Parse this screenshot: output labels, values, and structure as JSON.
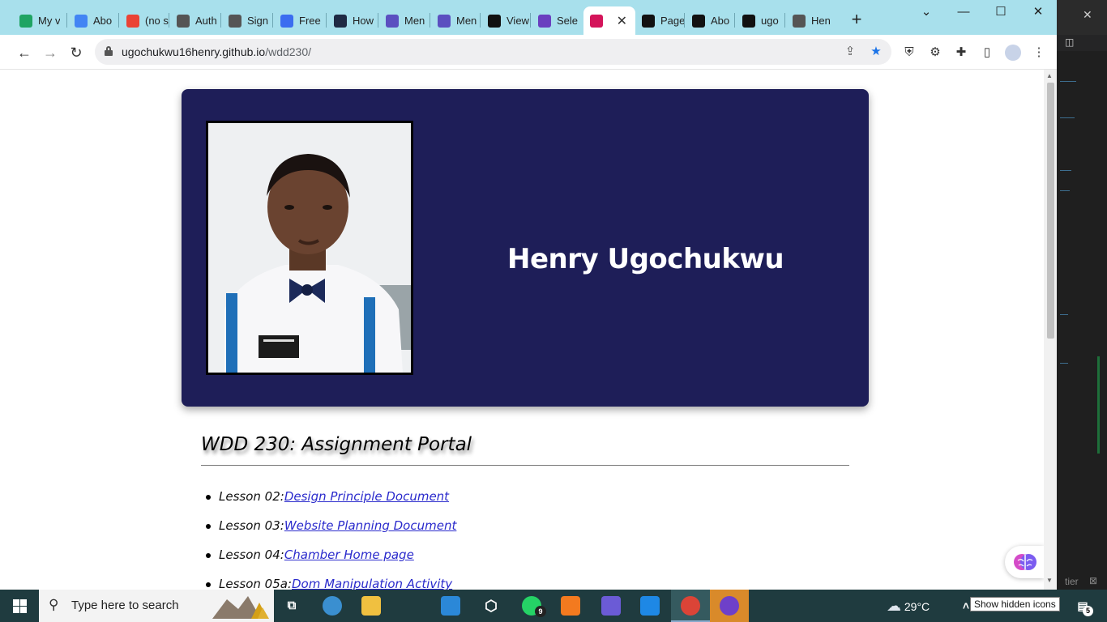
{
  "browser": {
    "tabs": [
      {
        "label": "My v",
        "icon": "google-drive-icon",
        "color": "#1fa463"
      },
      {
        "label": "Abo",
        "icon": "google-docs-icon",
        "color": "#4285f4"
      },
      {
        "label": "(no s",
        "icon": "gmail-icon",
        "color": "#ea4335"
      },
      {
        "label": "Auth",
        "icon": "globe-icon",
        "color": "#555555"
      },
      {
        "label": "Sign",
        "icon": "globe-icon",
        "color": "#555555"
      },
      {
        "label": "Free",
        "icon": "p-app-icon",
        "color": "#3b6df0"
      },
      {
        "label": "How",
        "icon": "a-app-icon",
        "color": "#1f2a44"
      },
      {
        "label": "Men",
        "icon": "forms-icon",
        "color": "#5b4fc0"
      },
      {
        "label": "Men",
        "icon": "forms-icon",
        "color": "#5b4fc0"
      },
      {
        "label": "View",
        "icon": "github-icon",
        "color": "#111111"
      },
      {
        "label": "Sele",
        "icon": "list-icon",
        "color": "#6a3fbf"
      },
      {
        "label": "",
        "icon": "m-logo-icon",
        "color": "#d4145a",
        "active": true
      },
      {
        "label": "Page",
        "icon": "github-icon",
        "color": "#111111"
      },
      {
        "label": "Abo",
        "icon": "github-icon",
        "color": "#111111"
      },
      {
        "label": "ugo",
        "icon": "github-icon",
        "color": "#111111"
      },
      {
        "label": "Hen",
        "icon": "globe-icon",
        "color": "#555555"
      }
    ],
    "url_host": "ugochukwu16henry.github.io",
    "url_path": "/wdd230/"
  },
  "page": {
    "name": "Henry Ugochukwu",
    "section_title": "WDD 230: Assignment Portal",
    "lessons": [
      {
        "prefix": "Lesson 02:",
        "link": "Design Principle Document"
      },
      {
        "prefix": "Lesson 03:",
        "link": "Website Planning Document"
      },
      {
        "prefix": "Lesson 04:",
        "link": "Chamber Home page"
      },
      {
        "prefix": "Lesson 05a:",
        "link": "Dom Manipulation Activity"
      }
    ]
  },
  "taskbar": {
    "search_placeholder": "Type here to search",
    "temperature": "29°C",
    "whatsapp_badge": "9",
    "notification_badge": "5",
    "tooltip": "Show hidden icons",
    "editor_hint": "tier"
  }
}
